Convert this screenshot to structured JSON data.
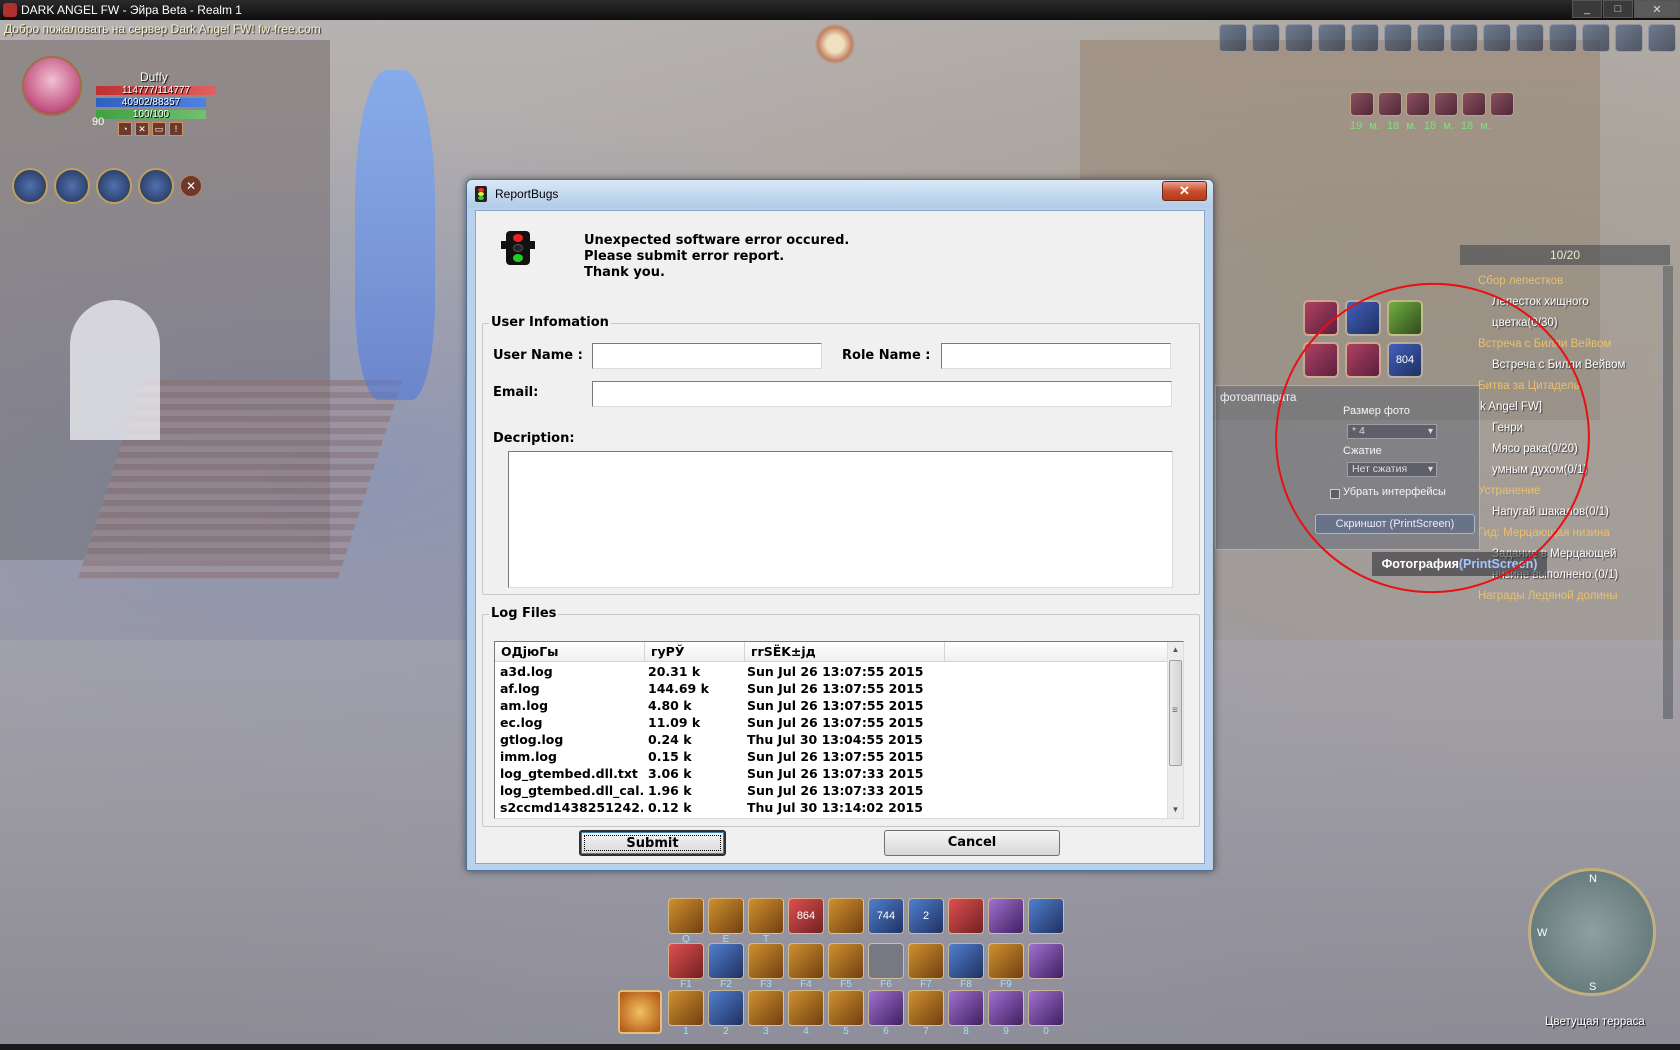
{
  "window": {
    "title": "DARK ANGEL FW - Эйра Beta - Realm 1",
    "minimize": "_",
    "maximize": "□",
    "close": "✕"
  },
  "welcome": "Добро пожаловать на сервер Dark Angel FW! fw-free.com",
  "character": {
    "name": "Duffy",
    "level": "90",
    "hp": "114777/114777",
    "mp": "40902/88357",
    "xp": "100/100"
  },
  "status_times": "19 м. 18 м. 18 м. 18 м.",
  "quest_tracker": {
    "count": "10/20",
    "lines": [
      {
        "text": "Сбор лепестков",
        "type": "title"
      },
      {
        "text": "Лепесток хищного",
        "type": "item"
      },
      {
        "text": "цветка(0/30)",
        "type": "item"
      },
      {
        "text": "Встреча с Билли Вейвом",
        "type": "title"
      },
      {
        "text": "Встреча с Билли Вейвом",
        "type": "item"
      },
      {
        "text": "Битва за Цитадель",
        "type": "title"
      },
      {
        "text": "k Angel FW]",
        "type": "item"
      },
      {
        "text": "Генри",
        "type": "item"
      },
      {
        "text": "Мясо рака(0/20)",
        "type": "item"
      },
      {
        "text": "умным духом(0/1)",
        "type": "item"
      },
      {
        "text": "Устранение",
        "type": "title"
      },
      {
        "text": "Напугай шакалов(0/1)",
        "type": "item"
      },
      {
        "text": "Гид: Мерцающая низина",
        "type": "title"
      },
      {
        "text": "Задание в Мерцающей",
        "type": "item"
      },
      {
        "text": "низине выполнено.(0/1)",
        "type": "item"
      },
      {
        "text": "Награды Ледяной долины",
        "type": "title"
      }
    ]
  },
  "skill_counter": "804",
  "photo": {
    "title": "фотоаппарата",
    "size_label": "Размер фото",
    "size_value": "* 4",
    "compress_label": "Сжатие",
    "compress_value": "Нет сжатия",
    "hide_ui_label": "Убрать интерфейсы",
    "screenshot_button": "Скриншот (PrintScreen)",
    "tip_text": "Фотография",
    "tip_key": "(PrintScreen)"
  },
  "hotbar": {
    "row1_counts": [
      "864",
      "744",
      "2"
    ],
    "row1_keys": [
      "Q",
      "E",
      "T"
    ],
    "row2_keys": [
      "F1",
      "F2",
      "F3",
      "F4",
      "F5",
      "F6",
      "F7",
      "F8",
      "F9"
    ],
    "row3_keys": [
      "1",
      "2",
      "3",
      "4",
      "5",
      "6",
      "7",
      "8",
      "9",
      "0"
    ]
  },
  "minimap": {
    "north": "N",
    "west": "W",
    "south": "S",
    "location": "Цветущая терраса"
  },
  "dialog": {
    "title": "ReportBugs",
    "close": "✕",
    "message": [
      "Unexpected software error occured.",
      "Please submit error report.",
      "Thank you."
    ],
    "user_info_legend": "User Infomation",
    "user_name_label": "User Name :",
    "user_name_value": "",
    "role_name_label": "Role Name :",
    "role_name_value": "",
    "email_label": "Email:",
    "email_value": "",
    "description_label": "Decription:",
    "description_value": "",
    "log_files_legend": "Log Files",
    "columns": [
      "ОДјюГы",
      "гуРЎ",
      "гrSЁK±jд"
    ],
    "rows": [
      {
        "name": "a3d.log",
        "size": "20.31 k",
        "time": "Sun Jul 26 13:07:55 2015"
      },
      {
        "name": "af.log",
        "size": "144.69 k",
        "time": "Sun Jul 26 13:07:55 2015"
      },
      {
        "name": "am.log",
        "size": "4.80 k",
        "time": "Sun Jul 26 13:07:55 2015"
      },
      {
        "name": "ec.log",
        "size": "11.09 k",
        "time": "Sun Jul 26 13:07:55 2015"
      },
      {
        "name": "gtlog.log",
        "size": "0.24 k",
        "time": "Thu Jul 30 13:04:55 2015"
      },
      {
        "name": "imm.log",
        "size": "0.15 k",
        "time": "Sun Jul 26 13:07:55 2015"
      },
      {
        "name": "log_gtembed.dll.txt",
        "size": "3.06 k",
        "time": "Sun Jul 26 13:07:33 2015"
      },
      {
        "name": "log_gtembed.dll_cal...",
        "size": "1.96 k",
        "time": "Sun Jul 26 13:07:33 2015"
      },
      {
        "name": "s2ccmd1438251242...",
        "size": "0.12 k",
        "time": "Thu Jul 30 13:14:02 2015"
      }
    ],
    "submit": "Submit",
    "cancel": "Cancel"
  }
}
